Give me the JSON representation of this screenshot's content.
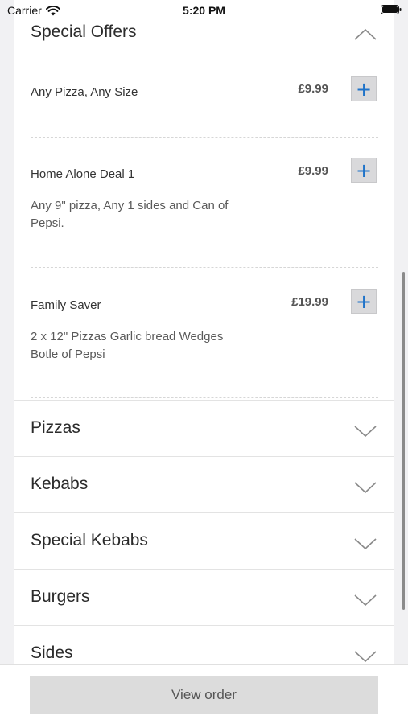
{
  "status_bar": {
    "carrier": "Carrier",
    "time": "5:20 PM",
    "icons": [
      "wifi-icon",
      "battery-icon"
    ]
  },
  "open_section": {
    "title": "Special Offers",
    "chevron": "chevron-up-icon",
    "items": [
      {
        "name": "Any Pizza, Any Size",
        "price": "£9.99",
        "description": ""
      },
      {
        "name": "Home Alone Deal 1",
        "price": "£9.99",
        "description": "Any 9\" pizza, Any 1 sides and Can of Pepsi."
      },
      {
        "name": "Family Saver",
        "price": "£19.99",
        "description": "2 x 12\" Pizzas Garlic bread Wedges Botle of Pepsi"
      }
    ],
    "add_icon": "plus-icon",
    "add_label": "+"
  },
  "collapsed_sections": [
    {
      "title": "Pizzas",
      "chevron": "chevron-down-icon"
    },
    {
      "title": "Kebabs",
      "chevron": "chevron-down-icon"
    },
    {
      "title": "Special Kebabs",
      "chevron": "chevron-down-icon"
    },
    {
      "title": "Burgers",
      "chevron": "chevron-down-icon"
    },
    {
      "title": "Sides",
      "chevron": "chevron-down-icon"
    }
  ],
  "footer": {
    "view_order_label": "View order"
  },
  "colors": {
    "accent": "#1f73c9",
    "background": "#f1f1f3",
    "button_bg": "#dcdcdc"
  }
}
